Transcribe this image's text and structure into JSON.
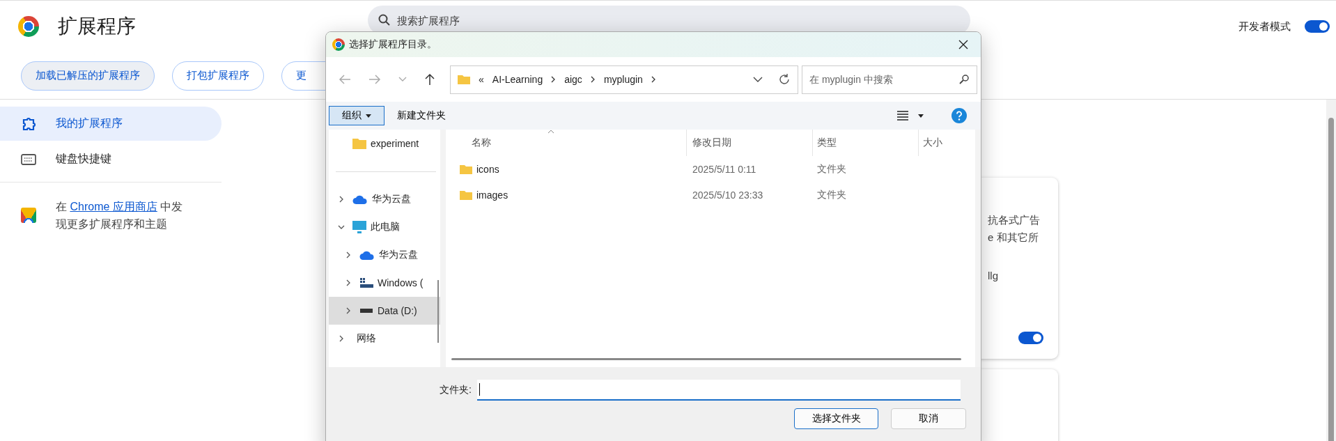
{
  "page": {
    "title": "扩展程序",
    "search_placeholder": "搜索扩展程序",
    "developer_mode": {
      "label": "开发者模式",
      "on": true
    }
  },
  "actions": [
    {
      "label": "加载已解压的扩展程序",
      "selected": true
    },
    {
      "label": "打包扩展程序",
      "selected": false
    },
    {
      "label": "更",
      "selected": false
    }
  ],
  "sidebar": {
    "items": [
      {
        "label": "我的扩展程序",
        "selected": true,
        "kind": "puzzle"
      },
      {
        "label": "键盘快捷键",
        "selected": false,
        "kind": "keyboard"
      }
    ],
    "promo": {
      "before": "在 ",
      "link": "Chrome 应用商店",
      "after": " 中发现更多扩展程序和主题"
    }
  },
  "extension_cards": [
    {
      "lines": [
        "抗各式广告",
        "e 和其它所",
        "llg"
      ],
      "enabled": true
    }
  ],
  "dialog": {
    "title": "选择扩展程序目录。",
    "breadcrumb": [
      "«",
      "AI-Learning",
      "aigc",
      "myplugin"
    ],
    "search_placeholder": "在 myplugin 中搜索",
    "toolbar": {
      "organize": "组织",
      "new_folder": "新建文件夹"
    },
    "nav_groups": [
      [
        {
          "label": "experiment",
          "kind": "folder",
          "selected": false
        }
      ],
      [
        {
          "label": "华为云盘",
          "kind": "cloud",
          "selected": false,
          "expanded": false
        },
        {
          "label": "此电脑",
          "kind": "pc",
          "selected": false,
          "expanded": true,
          "children": [
            {
              "label": "华为云盘",
              "kind": "cloud",
              "selected": false,
              "expanded": false
            },
            {
              "label": "Windows (",
              "kind": "windows-drive",
              "selected": false,
              "expanded": false
            },
            {
              "label": "Data (D:)",
              "kind": "drive",
              "selected": true,
              "expanded": false
            }
          ]
        },
        {
          "label": "网络",
          "kind": "network",
          "selected": false,
          "expanded": false
        }
      ]
    ],
    "columns": [
      "名称",
      "修改日期",
      "类型",
      "大小"
    ],
    "files": [
      {
        "name": "icons",
        "modified": "2025/5/11 0:11",
        "type": "文件夹"
      },
      {
        "name": "images",
        "modified": "2025/5/10 23:33",
        "type": "文件夹"
      }
    ],
    "folder_label": "文件夹:",
    "buttons": [
      {
        "label": "选择文件夹",
        "kind": "primary"
      },
      {
        "label": "取消",
        "kind": "secondary"
      }
    ]
  }
}
